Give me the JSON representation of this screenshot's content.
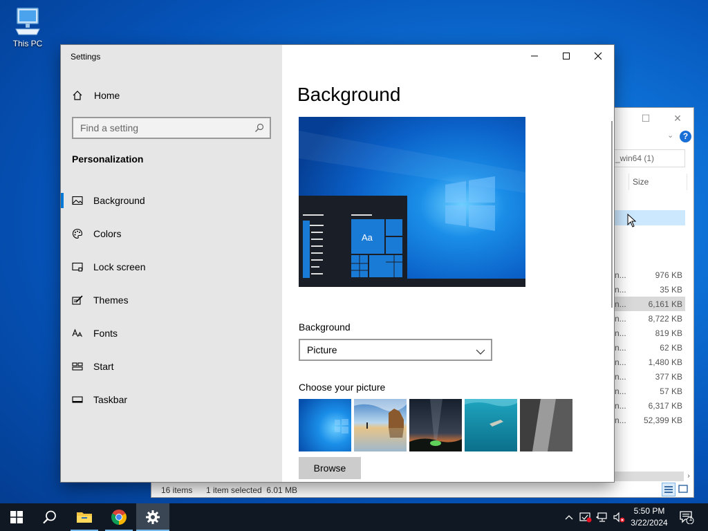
{
  "desktop": {
    "icon_label": "This PC"
  },
  "explorer": {
    "search_text": "_win64 (1)",
    "column_size": "Size",
    "rows": [
      {
        "name": "n...",
        "size": "976 KB"
      },
      {
        "name": "n...",
        "size": "35 KB"
      },
      {
        "name": "n...",
        "size": "6,161 KB"
      },
      {
        "name": "n...",
        "size": "8,722 KB"
      },
      {
        "name": "n...",
        "size": "819 KB"
      },
      {
        "name": "n...",
        "size": "62 KB"
      },
      {
        "name": "n...",
        "size": "1,480 KB"
      },
      {
        "name": "n...",
        "size": "377 KB"
      },
      {
        "name": "n...",
        "size": "57 KB"
      },
      {
        "name": "n...",
        "size": "6,317 KB"
      },
      {
        "name": "n...",
        "size": "52,399 KB"
      }
    ],
    "status_items": "16 items",
    "status_selected": "1 item selected  6.01 MB"
  },
  "settings": {
    "window_title": "Settings",
    "home_label": "Home",
    "search_placeholder": "Find a setting",
    "section_heading": "Personalization",
    "nav": [
      {
        "label": "Background",
        "icon": "picture-icon",
        "selected": true
      },
      {
        "label": "Colors",
        "icon": "palette-icon",
        "selected": false
      },
      {
        "label": "Lock screen",
        "icon": "lock-screen-icon",
        "selected": false
      },
      {
        "label": "Themes",
        "icon": "themes-icon",
        "selected": false
      },
      {
        "label": "Fonts",
        "icon": "fonts-icon",
        "selected": false
      },
      {
        "label": "Start",
        "icon": "start-icon",
        "selected": false
      },
      {
        "label": "Taskbar",
        "icon": "taskbar-icon",
        "selected": false
      }
    ],
    "page_title": "Background",
    "preview_sample_text": "Aa",
    "background_label": "Background",
    "background_value": "Picture",
    "choose_picture_label": "Choose your picture",
    "browse_label": "Browse",
    "accent_color": "#0078d7"
  },
  "taskbar": {
    "apps": [
      "windows-start-icon",
      "search-icon",
      "file-explorer-icon",
      "chrome-icon",
      "settings-gear-icon"
    ],
    "time": "5:50 PM",
    "date": "3/22/2024",
    "notification_count": "1"
  }
}
